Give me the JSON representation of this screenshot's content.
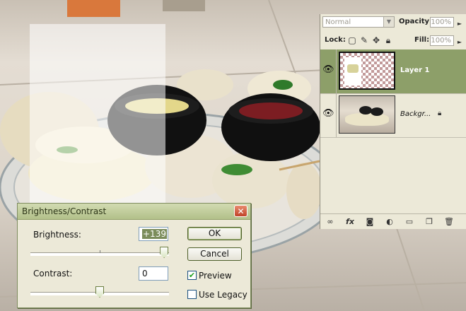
{
  "layers_panel": {
    "blend_mode": "Normal",
    "opacity_label": "Opacity:",
    "opacity_value": "100%",
    "lock_label": "Lock:",
    "fill_label": "Fill:",
    "fill_value": "100%",
    "lock_icons": [
      "lock-transparent-icon",
      "lock-paint-icon",
      "lock-move-icon",
      "lock-all-icon"
    ],
    "layers": [
      {
        "name": "Layer 1",
        "selected": true,
        "visible": true
      },
      {
        "name": "Backgr...",
        "selected": false,
        "visible": true,
        "locked": true
      }
    ],
    "bottom_icons": [
      "link-icon",
      "fx-icon",
      "mask-icon",
      "adjustment-icon",
      "group-icon",
      "new-layer-icon",
      "trash-icon"
    ]
  },
  "dialog": {
    "title": "Brightness/Contrast",
    "brightness_label": "Brightness:",
    "brightness_value": "+139",
    "brightness_level": 0.965,
    "contrast_label": "Contrast:",
    "contrast_value": "0",
    "contrast_level": 0.5,
    "ok_label": "OK",
    "cancel_label": "Cancel",
    "preview_label": "Preview",
    "preview_checked": true,
    "legacy_label": "Use Legacy",
    "legacy_checked": false
  },
  "colors": {
    "selected_layer": "#8d9f69",
    "titlebar": "#b2c089",
    "close_button": "#c0432a"
  }
}
